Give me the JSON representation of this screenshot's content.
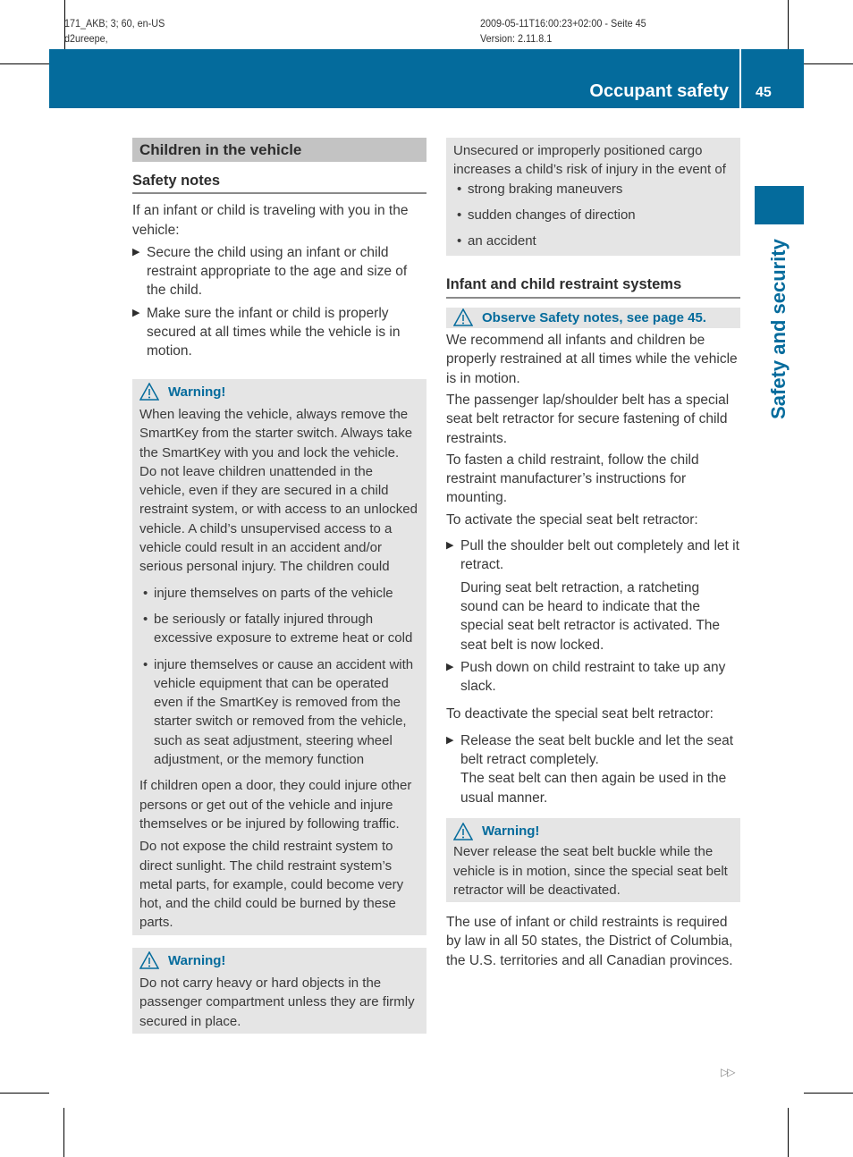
{
  "meta": {
    "left_line1": "171_AKB; 3; 60, en-US",
    "left_line2": "d2ureepe,",
    "right_line1": "2009-05-11T16:00:23+02:00 - Seite 45",
    "right_line2": "Version: 2.11.8.1"
  },
  "header": {
    "title": "Occupant safety",
    "page_number": "45",
    "color": "#046b9c"
  },
  "side_tab": {
    "label": "Safety and security"
  },
  "left_column": {
    "section_title": "Children in the vehicle",
    "subheading": "Safety notes",
    "intro": "If an infant or child is traveling with you in the vehicle:",
    "steps": [
      "Secure the child using an infant or child restraint appropriate to the age and size of the child.",
      "Make sure the infant or child is properly secured at all times while the vehicle is in motion."
    ],
    "warning1": {
      "title": "Warning!",
      "text": "When leaving the vehicle, always remove the SmartKey from the starter switch. Always take the SmartKey with you and lock the vehicle. Do not leave children unattended in the vehicle, even if they are secured in a child restraint system, or with access to an unlocked vehicle. A child’s unsupervised access to a vehicle could result in an accident and/or serious personal injury. The children could",
      "bullets": [
        "injure themselves on parts of the vehicle",
        "be seriously or fatally injured through excessive exposure to extreme heat or cold",
        "injure themselves or cause an accident with vehicle equipment that can be operated even if the SmartKey is removed from the starter switch or removed from the vehicle, such as seat adjustment, steering wheel adjustment, or the memory function"
      ],
      "para2": "If children open a door, they could injure other persons or get out of the vehicle and injure themselves or be injured by following traffic.",
      "para3": "Do not expose the child restraint system to direct sunlight. The child restraint system’s metal parts, for example, could become very hot, and the child could be burned by these parts."
    },
    "warning2": {
      "title": "Warning!",
      "text": "Do not carry heavy or hard objects in the passenger compartment unless they are firmly secured in place."
    }
  },
  "right_column": {
    "cargo_box": {
      "text": "Unsecured or improperly positioned cargo increases a child’s risk of injury in the event of",
      "bullets": [
        "strong braking maneuvers",
        "sudden changes of direction",
        "an accident"
      ]
    },
    "subheading": "Infant and child restraint systems",
    "note": "Observe Safety notes, see page 45.",
    "para1": "We recommend all infants and children be properly restrained at all times while the vehicle is in motion.",
    "para2": "The passenger lap/shoulder belt has a special seat belt retractor for secure fastening of child restraints.",
    "para3": "To fasten a child restraint, follow the child restraint manufacturer’s instructions for mounting.",
    "activate_intro": "To activate the special seat belt retractor:",
    "activate_steps": [
      {
        "text": "Pull the shoulder belt out completely and let it retract.",
        "result": "During seat belt retraction, a ratcheting sound can be heard to indicate that the special seat belt retractor is activated. The seat belt is now locked."
      },
      {
        "text": "Push down on child restraint to take up any slack."
      }
    ],
    "deactivate_intro": "To deactivate the special seat belt retractor:",
    "deactivate_steps": [
      {
        "text": "Release the seat belt buckle and let the seat belt retract completely.",
        "result": "The seat belt can then again be used in the usual manner."
      }
    ],
    "warning": {
      "title": "Warning!",
      "text": "Never release the seat belt buckle while the vehicle is in motion, since the special seat belt retractor will be deactivated."
    },
    "closing": "The use of infant or child restraints is required by law in all 50 states, the District of Columbia, the U.S. territories and all Canadian provinces."
  },
  "footer": {
    "continue_icon": "double-triangle-right-icon"
  }
}
